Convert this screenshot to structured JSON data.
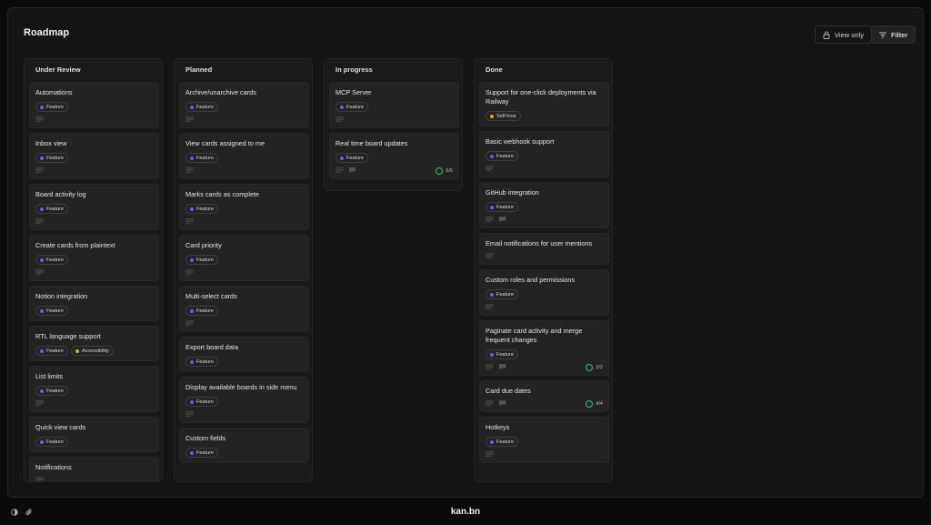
{
  "header": {
    "title": "Roadmap",
    "view_only_label": "View only",
    "filter_label": "Filter"
  },
  "colors": {
    "feature": "#6c5ce7",
    "self_host": "#f0a030",
    "accessibility": "#9acd32",
    "checklist": "#3fbf6a"
  },
  "columns": [
    {
      "title": "Under Review",
      "cards": [
        {
          "title": "Automations",
          "labels": [
            {
              "text": "Feature",
              "color": "#6c5ce7"
            }
          ]
        },
        {
          "title": "Inbox view",
          "labels": [
            {
              "text": "Feature",
              "color": "#6c5ce7"
            }
          ]
        },
        {
          "title": "Board activity log",
          "labels": [
            {
              "text": "Feature",
              "color": "#6c5ce7"
            }
          ]
        },
        {
          "title": "Create cards from plaintext",
          "labels": [
            {
              "text": "Feature",
              "color": "#6c5ce7"
            }
          ]
        },
        {
          "title": "Notion integration",
          "labels": [
            {
              "text": "Feature",
              "color": "#6c5ce7"
            }
          ],
          "nodesc": true
        },
        {
          "title": "RTL language support",
          "labels": [
            {
              "text": "Feature",
              "color": "#6c5ce7"
            },
            {
              "text": "Accessibility",
              "color": "#9acd32"
            }
          ],
          "nodesc": true
        },
        {
          "title": "List limits",
          "labels": [
            {
              "text": "Feature",
              "color": "#6c5ce7"
            }
          ]
        },
        {
          "title": "Quick view cards",
          "labels": [
            {
              "text": "Feature",
              "color": "#6c5ce7"
            }
          ],
          "nodesc": true
        },
        {
          "title": "Notifications",
          "labels": []
        }
      ]
    },
    {
      "title": "Planned",
      "cards": [
        {
          "title": "Archive/unarchive cards",
          "labels": [
            {
              "text": "Feature",
              "color": "#6c5ce7"
            }
          ]
        },
        {
          "title": "View cards assigned to me",
          "labels": [
            {
              "text": "Feature",
              "color": "#6c5ce7"
            }
          ]
        },
        {
          "title": "Marks cards as complete",
          "labels": [
            {
              "text": "Feature",
              "color": "#6c5ce7"
            }
          ]
        },
        {
          "title": "Card priority",
          "labels": [
            {
              "text": "Feature",
              "color": "#6c5ce7"
            }
          ]
        },
        {
          "title": "Multi-select cards",
          "labels": [
            {
              "text": "Feature",
              "color": "#6c5ce7"
            }
          ]
        },
        {
          "title": "Export board data",
          "labels": [
            {
              "text": "Feature",
              "color": "#6c5ce7"
            }
          ],
          "nodesc": true
        },
        {
          "title": "Display available boards in side menu",
          "labels": [
            {
              "text": "Feature",
              "color": "#6c5ce7"
            }
          ]
        },
        {
          "title": "Custom fields",
          "labels": [
            {
              "text": "Feature",
              "color": "#6c5ce7"
            }
          ],
          "nodesc": true
        }
      ]
    },
    {
      "title": "In progress",
      "cards": [
        {
          "title": "MCP Server",
          "labels": [
            {
              "text": "Feature",
              "color": "#6c5ce7"
            }
          ]
        },
        {
          "title": "Real time board updates",
          "labels": [
            {
              "text": "Feature",
              "color": "#6c5ce7"
            }
          ],
          "comment": true,
          "checklist": "5/5"
        }
      ]
    },
    {
      "title": "Done",
      "cards": [
        {
          "title": "Support for one-click deployments via Railway",
          "labels": [
            {
              "text": "Self-host",
              "color": "#f0a030"
            }
          ],
          "nodesc": true
        },
        {
          "title": "Basic webhook support",
          "labels": [
            {
              "text": "Feature",
              "color": "#6c5ce7"
            }
          ]
        },
        {
          "title": "GitHub integration",
          "labels": [
            {
              "text": "Feature",
              "color": "#6c5ce7"
            }
          ],
          "comment": true
        },
        {
          "title": "Email notifications for user mentions",
          "labels": []
        },
        {
          "title": "Custom roles and permissions",
          "labels": [
            {
              "text": "Feature",
              "color": "#6c5ce7"
            }
          ]
        },
        {
          "title": "Paginate card activity and merge frequent changes",
          "labels": [
            {
              "text": "Feature",
              "color": "#6c5ce7"
            }
          ],
          "comment": true,
          "checklist": "2/2"
        },
        {
          "title": "Card due dates",
          "labels": [],
          "comment": true,
          "checklist": "4/4"
        },
        {
          "title": "Hotkeys",
          "labels": [
            {
              "text": "Feature",
              "color": "#6c5ce7"
            }
          ]
        }
      ]
    }
  ],
  "footer": {
    "brand": "kan.bn"
  }
}
